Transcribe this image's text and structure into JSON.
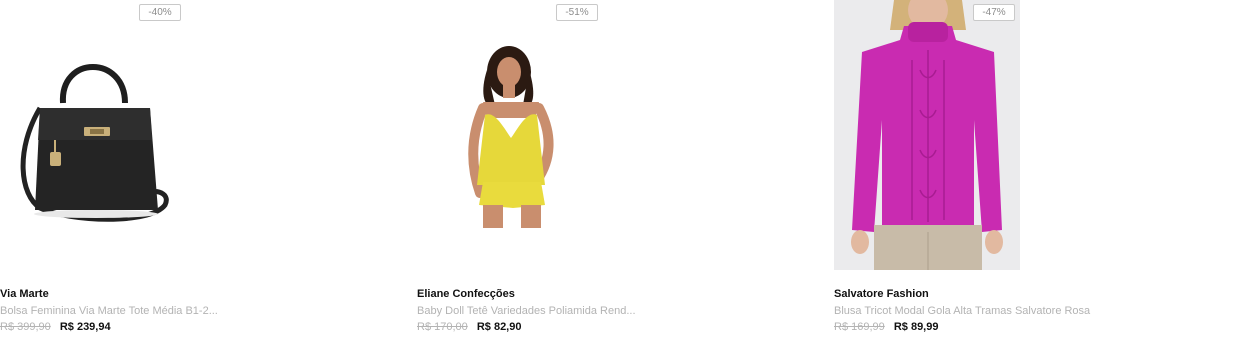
{
  "products": [
    {
      "discount": "-40%",
      "image_alt": "black-handbag",
      "brand": "Via Marte",
      "name": "Bolsa Feminina Via Marte Tote Média B1-2...",
      "old_price": "R$ 399,90",
      "price": "R$ 239,94"
    },
    {
      "discount": "-51%",
      "image_alt": "yellow-baby-doll",
      "brand": "Eliane Confecções",
      "name": "Baby Doll Tetê Variedades Poliamida Rend...",
      "old_price": "R$ 170,00",
      "price": "R$ 82,90"
    },
    {
      "discount": "-47%",
      "image_alt": "pink-sweater",
      "brand": "Salvatore Fashion",
      "name": "Blusa Tricot Modal Gola Alta Tramas Salvatore Rosa",
      "old_price": "R$ 169,99",
      "price": "R$ 89,99"
    }
  ]
}
